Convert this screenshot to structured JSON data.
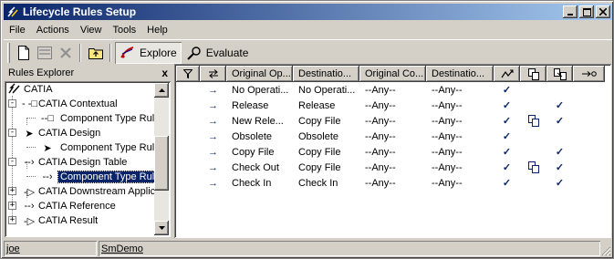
{
  "window": {
    "title": "Lifecycle Rules Setup",
    "buttons": {
      "minimize": "_",
      "maximize": "□",
      "close": "X"
    }
  },
  "menu": {
    "items": [
      "File",
      "Actions",
      "View",
      "Tools",
      "Help"
    ]
  },
  "toolbar": {
    "icons": [
      "new-icon",
      "properties-icon",
      "delete-icon",
      "up-folder-icon"
    ],
    "explore_label": "Explore",
    "evaluate_label": "Evaluate"
  },
  "explorer": {
    "title": "Rules Explorer",
    "close_label": "x",
    "tree": [
      {
        "label": "CATIA",
        "level": 0,
        "expander": "",
        "glyph": "catia-root-icon"
      },
      {
        "label": "CATIA Contextual",
        "level": 1,
        "expander": "-",
        "glyph": "contextual-icon"
      },
      {
        "label": "Component Type Rule",
        "level": 2,
        "expander": "",
        "glyph": "rule-icon"
      },
      {
        "label": "CATIA Design",
        "level": 1,
        "expander": "-",
        "glyph": "design-icon"
      },
      {
        "label": "Component Type Rule",
        "level": 2,
        "expander": "",
        "glyph": "rule-icon"
      },
      {
        "label": "CATIA Design Table",
        "level": 1,
        "expander": "-",
        "glyph": "design-table-icon"
      },
      {
        "label": "Component Type Rule",
        "level": 2,
        "expander": "",
        "glyph": "rule-icon",
        "selected": true
      },
      {
        "label": "CATIA Downstream Applic",
        "level": 1,
        "expander": "+",
        "glyph": "downstream-icon"
      },
      {
        "label": "CATIA Reference",
        "level": 1,
        "expander": "+",
        "glyph": "reference-icon"
      },
      {
        "label": "CATIA Result",
        "level": 1,
        "expander": "+",
        "glyph": "result-icon"
      }
    ]
  },
  "grid": {
    "columns": [
      {
        "label": "",
        "icon": "filter-icon"
      },
      {
        "label": "",
        "icon": "swap-icon"
      },
      {
        "label": "Original Op..."
      },
      {
        "label": "Destinatio..."
      },
      {
        "label": "Original Co..."
      },
      {
        "label": "Destinatio..."
      },
      {
        "label": "",
        "icon": "transition-icon"
      },
      {
        "label": "",
        "icon": "copy-icon"
      },
      {
        "label": "",
        "icon": "copy-multi-icon"
      },
      {
        "label": "",
        "icon": "link-icon"
      }
    ],
    "rows": [
      {
        "arrow": "→",
        "orig_op": "No Operati...",
        "dest_op": "No Operati...",
        "orig_cond": "--Any--",
        "dest_cond": "--Any--",
        "c1": "✓",
        "c2": "",
        "c3": ""
      },
      {
        "arrow": "→",
        "orig_op": "Release",
        "dest_op": "Release",
        "orig_cond": "--Any--",
        "dest_cond": "--Any--",
        "c1": "✓",
        "c2": "",
        "c3": "✓"
      },
      {
        "arrow": "→",
        "orig_op": "New Rele...",
        "dest_op": "Copy File",
        "orig_cond": "--Any--",
        "dest_cond": "--Any--",
        "c1": "✓",
        "c2": "copy",
        "c3": "✓"
      },
      {
        "arrow": "→",
        "orig_op": "Obsolete",
        "dest_op": "Obsolete",
        "orig_cond": "--Any--",
        "dest_cond": "--Any--",
        "c1": "✓",
        "c2": "",
        "c3": ""
      },
      {
        "arrow": "→",
        "orig_op": "Copy File",
        "dest_op": "Copy File",
        "orig_cond": "--Any--",
        "dest_cond": "--Any--",
        "c1": "✓",
        "c2": "",
        "c3": "✓"
      },
      {
        "arrow": "→",
        "orig_op": "Check Out",
        "dest_op": "Copy File",
        "orig_cond": "--Any--",
        "dest_cond": "--Any--",
        "c1": "✓",
        "c2": "copy",
        "c3": "✓"
      },
      {
        "arrow": "→",
        "orig_op": "Check In",
        "dest_op": "Check In",
        "orig_cond": "--Any--",
        "dest_cond": "--Any--",
        "c1": "✓",
        "c2": "",
        "c3": "✓"
      }
    ]
  },
  "status": {
    "user": "joe",
    "vault": "SmDemo"
  },
  "colors": {
    "titlebar_start": "#0a246a",
    "titlebar_end": "#a6caf0",
    "selection": "#0a246a",
    "check": "#0a246a"
  }
}
